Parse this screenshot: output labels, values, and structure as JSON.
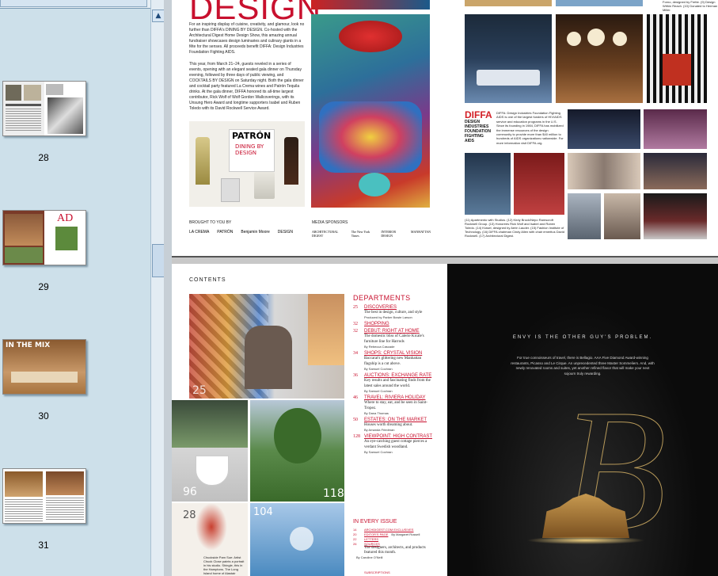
{
  "thumbnails": [
    {
      "page": "28",
      "label": ""
    },
    {
      "page": "29",
      "label": "AD"
    },
    {
      "page": "30",
      "label": "IN THE MIX"
    },
    {
      "page": "31",
      "label": ""
    }
  ],
  "page1": {
    "headline": "DESIGN",
    "intro": "For an inspiring display of cuisine, creativity, and glamour, look no further than DIFFA's DINING BY DESIGN. Co-hosted with the Architectural Digest Home Design Show, this amazing annual fundraiser showcases design luminaries and culinary giants in a fête for the senses. All proceeds benefit DIFFA: Design Industries Foundation Fighting AIDS.",
    "body": "This year, from March 21–24, guests reveled in a series of events, opening with an elegant seated gala dinner on Thursday evening, followed by three days of public viewing, and COCKTAILS BY DESIGN on Saturday night. Both the gala dinner and cocktail party featured La Crema wines and Patrón Tequila drinks. At the gala dinner, DIFFA honored its all-time largest contributor, Rick Wolf of Wolf Gordon Wallcoverings, with its Unsung Hero Award and longtime supporters Isabel and Ruben Toledo with its David Rockwell Service Award.",
    "patron": "PATRÓN",
    "dining_by_design": "DINING BY DESIGN",
    "brought_to_you": "BROUGHT TO YOU BY",
    "media_sponsors": "MEDIA SPONSORS",
    "sponsors": [
      "LA CREMA",
      "PATRÓN",
      "Benjamin Moore",
      "DESIGN"
    ],
    "media": [
      "ARCHITECTURAL DIGEST",
      "The New York Times",
      "INTERIOR DESIGN",
      "MANHATTAN"
    ],
    "diffa_logo": "DIFFA",
    "diffa_sub": "DESIGN INDUSTRIES FOUNDATION FIGHTING AIDS",
    "diffa_text": "DIFFA: Design Industries Foundation Fighting AIDS is one of the largest funders of HIV/AIDS service and education programs in the U.S. Since its founding in 1984, DIFFA has mobilized the immense resources of the design community to provide more than $40 million to hundreds of AIDS organizations nationwide. For more information visit DIFFA.org.",
    "captions": "Forno, designed by Frette. (9) Design Within Reach. (10) Donated to Herman Miller.",
    "bottom_caption": "(11) Apartmento with Studios. (12) Kirdy Brock/Nepo Ramscroft Rockwell Group. (13) Honorees Rick Wolf and Isabel and Ruben Toledo. (14) Krasel, designed by Aerin Lauder. (15) Fashion Institute of Technology. (16) DIFFA chairman Cindy Allen with chair emeritus David Rockwell. (17) Architectural Digest."
  },
  "page2": {
    "contents": "CONTENTS",
    "departments": "DEPARTMENTS",
    "entries": [
      {
        "num": "25",
        "title": "DISCOVERIES",
        "desc": "The best in design, culture, and style",
        "by": "Produced by Parker Bowie Larson"
      },
      {
        "num": "32",
        "title": "SHOPPING",
        "desc": "",
        "by": ""
      },
      {
        "num": "32",
        "title": "DEBUT: RIGHT AT HOME",
        "desc": "The domestic bliss of Calerie Kicale's furniture line for Harrods",
        "by": "By Rebecca Cascade"
      },
      {
        "num": "34",
        "title": "SHOPS: CRYSTAL VISION",
        "desc": "Baccarat's glittering new Manhattan flagship is a cut above.",
        "by": "By Samuel Cochran"
      },
      {
        "num": "36",
        "title": "AUCTIONS: EXCHANGE RATE",
        "desc": "Key results and fascinating finds from the latest sales around the world.",
        "by": "By Samuel Cochran"
      },
      {
        "num": "46",
        "title": "TRAVEL: RIVIERA HOLIDAY",
        "desc": "Where to stay, eat, and be seen in Saint-Tropez.",
        "by": "By Dana Thomas"
      },
      {
        "num": "50",
        "title": "ESTATES: ON THE MARKET",
        "desc": "Houses worth dreaming about.",
        "by": "By Amanda Friedman"
      },
      {
        "num": "128",
        "title": "VIEWPOINT: HIGH CONTRAST",
        "desc": "An eye-catching guest cottage pierces a verdant Swedish woodland.",
        "by": "By Samuel Cochran"
      }
    ],
    "every_issue": "IN EVERY ISSUE",
    "issue_items": [
      {
        "num": "14",
        "title": "ARCHDIGEST.COM EXCLUSIVES"
      },
      {
        "num": "20",
        "title": "EDITOR'S PAGE",
        "by": "By Margaret Russell"
      },
      {
        "num": "22",
        "title": "LETTERS"
      },
      {
        "num": "26",
        "title": "SOURCES",
        "desc": "The designers, architects, and products featured this month.",
        "by": "By Caroline O'Neill"
      }
    ],
    "subscriptions": "SUBSCRIPTIONS",
    "photo_numbers": [
      "25",
      "96",
      "118",
      "28",
      "104"
    ],
    "photo_caption": "Chuckside Pam Sue: Artist Chuck Close paints a portrait in his studio. Shingle, this in the Hamptons. The Long Island home of Alastair",
    "ad_headline": "ENVY IS THE OTHER GUY'S PROBLEM.",
    "ad_body": "For true connoisseurs of travel, there is Bellagio. AAA Five Diamond Award-winning restaurants, Picasso and Le Cirque. An unprecedented three Master Sommeliers. And, with newly renovated rooms and suites, yet another refined flavor that will make your next sojourn truly rewarding.",
    "ad_letter": "B"
  },
  "colors": {
    "accent": "#c8102e",
    "diffa": "#d31f26",
    "sidebar": "#cde0ea",
    "ad_bg": "#0b0b0b"
  }
}
